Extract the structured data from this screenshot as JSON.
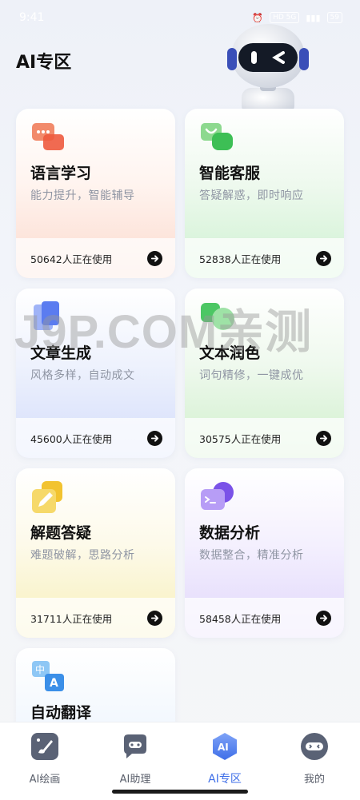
{
  "status_bar": {
    "time": "9:41",
    "signal_text": "HD 5G",
    "battery": "59"
  },
  "header": {
    "title": "AI专区"
  },
  "watermark": "J9P.COM亲测",
  "cards": [
    {
      "title": "语言学习",
      "subtitle": "能力提升，智能辅导",
      "count": "50642人正在使用",
      "icon": "chat-bubbles-icon",
      "accent": "#f06a4d"
    },
    {
      "title": "智能客服",
      "subtitle": "答疑解惑，即时响应",
      "count": "52838人正在使用",
      "icon": "headset-chat-icon",
      "accent": "#3dbf55"
    },
    {
      "title": "文章生成",
      "subtitle": "风格多样，自动成文",
      "count": "45600人正在使用",
      "icon": "document-icon",
      "accent": "#5b7cf0"
    },
    {
      "title": "文本润色",
      "subtitle": "词句精修，一键成优",
      "count": "30575人正在使用",
      "icon": "polish-icon",
      "accent": "#4cc764"
    },
    {
      "title": "解题答疑",
      "subtitle": "难题破解，思路分析",
      "count": "31711人正在使用",
      "icon": "pencil-icon",
      "accent": "#f2c330"
    },
    {
      "title": "数据分析",
      "subtitle": "数据整合，精准分析",
      "count": "58458人正在使用",
      "icon": "terminal-icon",
      "accent": "#8e6cf0"
    },
    {
      "title": "自动翻译",
      "subtitle": "",
      "count": "",
      "icon": "translate-icon",
      "accent": "#4aa3f0"
    }
  ],
  "tabs": [
    {
      "label": "AI绘画",
      "icon": "paint-brush-icon",
      "active": false
    },
    {
      "label": "AI助理",
      "icon": "assistant-chat-icon",
      "active": false
    },
    {
      "label": "AI专区",
      "icon": "ai-zone-icon",
      "active": true
    },
    {
      "label": "我的",
      "icon": "profile-robot-icon",
      "active": false
    }
  ],
  "colors": {
    "active_tab": "#3f6fe8",
    "text_primary": "#111111",
    "text_secondary": "#8f95a3"
  }
}
